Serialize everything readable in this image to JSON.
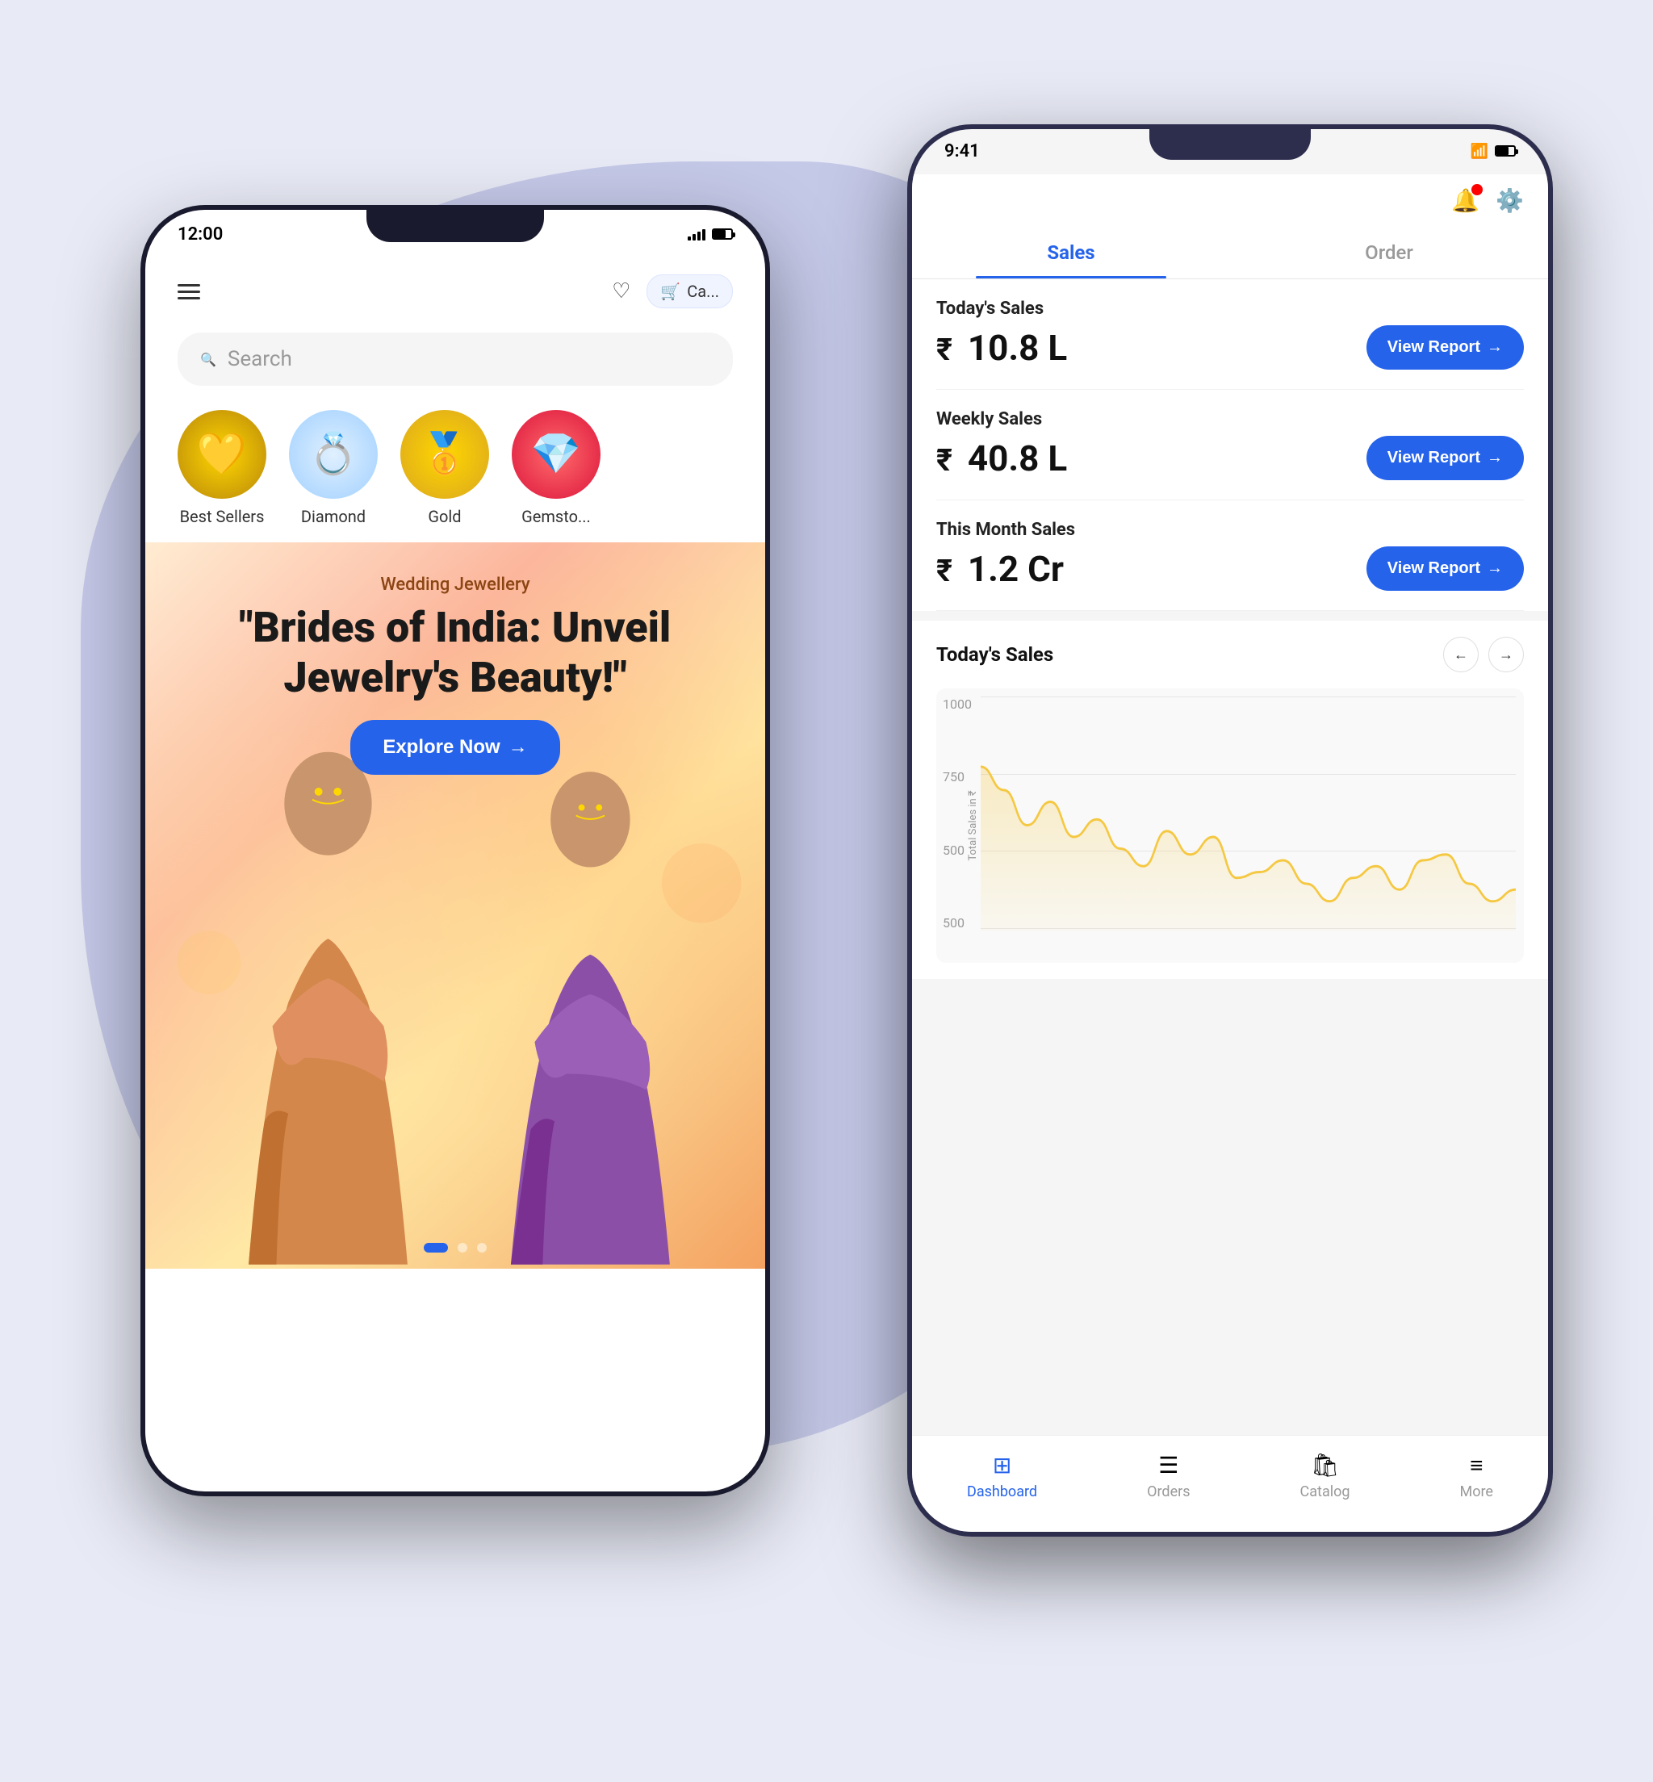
{
  "background": {
    "color": "#dde0f5"
  },
  "phone_left": {
    "status_bar": {
      "time": "12:00"
    },
    "header": {
      "cart_label": "Ca..."
    },
    "search": {
      "placeholder": "Search"
    },
    "categories": [
      {
        "id": "best-sellers",
        "label": "Best Sellers",
        "emoji": "💛"
      },
      {
        "id": "diamond",
        "label": "Diamond",
        "emoji": "💍"
      },
      {
        "id": "gold",
        "label": "Gold",
        "emoji": "🥇"
      },
      {
        "id": "gemstone",
        "label": "Gemsto...",
        "emoji": "💎"
      }
    ],
    "banner": {
      "subtitle": "Wedding Jewellery",
      "title": "\"Brides of India: Unveil Jewelry's Beauty!\"",
      "button_label": "Explore Now",
      "button_arrow": "→"
    },
    "dots": [
      {
        "active": true
      },
      {
        "active": false
      },
      {
        "active": false
      }
    ]
  },
  "phone_right": {
    "status_bar": {
      "time": "9:41"
    },
    "tabs": [
      {
        "id": "sales",
        "label": "Sales",
        "active": true
      },
      {
        "id": "order",
        "label": "Order",
        "active": false
      }
    ],
    "sales_cards": [
      {
        "id": "today",
        "label": "Today's Sales",
        "amount": "10.8 L",
        "currency": "₹",
        "button_label": "View Report",
        "button_arrow": "→"
      },
      {
        "id": "weekly",
        "label": "Weekly Sales",
        "amount": "40.8 L",
        "currency": "₹",
        "button_label": "View Report",
        "button_arrow": "→"
      },
      {
        "id": "monthly",
        "label": "This Month Sales",
        "amount": "1.2 Cr",
        "currency": "₹",
        "button_label": "View Report",
        "button_arrow": "→"
      }
    ],
    "chart": {
      "title": "Today's Sales",
      "nav_prev": "←",
      "nav_next": "→",
      "y_axis_label": "Total Sales in ₹",
      "y_labels": [
        "1000",
        "750",
        "500",
        "500"
      ],
      "x_labels": [
        "",
        "",
        "",
        "",
        "",
        "",
        "",
        ""
      ],
      "data_points": [
        580,
        540,
        480,
        520,
        460,
        490,
        440,
        410,
        470,
        430,
        460,
        390,
        400,
        420,
        380,
        350,
        390,
        410,
        370,
        420,
        430,
        380,
        350,
        370
      ]
    },
    "bottom_nav": [
      {
        "id": "dashboard",
        "label": "Dashboard",
        "icon": "⊞",
        "active": true
      },
      {
        "id": "orders",
        "label": "Orders",
        "icon": "☰",
        "active": false
      },
      {
        "id": "catalog",
        "label": "Catalog",
        "icon": "🛍",
        "active": false
      },
      {
        "id": "more",
        "label": "More",
        "icon": "≡",
        "active": false
      }
    ]
  }
}
